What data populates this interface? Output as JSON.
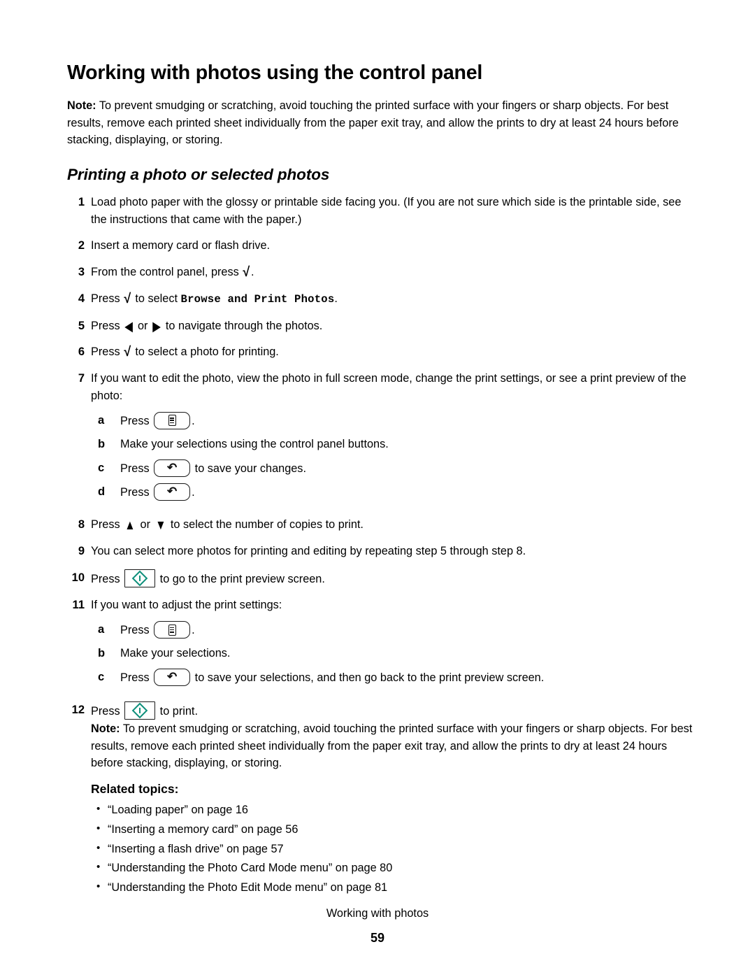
{
  "document": {
    "title": "Working with photos using the control panel",
    "subtitle": "Printing a photo or selected photos",
    "intro_note_label": "Note:",
    "intro_note_text": " To prevent smudging or scratching, avoid touching the printed surface with your fingers or sharp objects. For best results, remove each printed sheet individually from the paper exit tray, and allow the prints to dry at least 24 hours before stacking, displaying, or storing."
  },
  "steps": [
    {
      "num": "1",
      "text": "Load photo paper with the glossy or printable side facing you. (If you are not sure which side is the printable side, see the instructions that came with the paper.)"
    },
    {
      "num": "2",
      "text": "Insert a memory card or flash drive."
    },
    {
      "num": "3",
      "pre": "From the control panel, press ",
      "glyph": "√",
      "post": "."
    },
    {
      "num": "4",
      "pre": "Press ",
      "glyph": "√",
      "mid": " to select ",
      "mono": "Browse and Print Photos",
      "post": "."
    },
    {
      "num": "5",
      "pre": "Press ",
      "glyph_left": "◀",
      "mid": " or ",
      "glyph_right": "▶",
      "post": " to navigate through the photos."
    },
    {
      "num": "6",
      "pre": "Press ",
      "glyph": "√",
      "post": " to select a photo for printing."
    },
    {
      "num": "7",
      "text": "If you want to edit the photo, view the photo in full screen mode, change the print settings, or see a print preview of the photo:",
      "substeps": [
        {
          "letter": "a",
          "pre": "Press ",
          "button": "menu-button",
          "post": "."
        },
        {
          "letter": "b",
          "pre": "Make your selections using the control panel buttons.",
          "button": null,
          "post": ""
        },
        {
          "letter": "c",
          "pre": "Press ",
          "button": "back-button",
          "post": " to save your changes."
        },
        {
          "letter": "d",
          "pre": "Press ",
          "button": "back-button",
          "post": "."
        }
      ]
    },
    {
      "num": "8",
      "pre": "Press ",
      "glyph_up": "▲",
      "mid": " or ",
      "glyph_down": "▼",
      "post": " to select the number of copies to print."
    },
    {
      "num": "9",
      "text": "You can select more photos for printing and editing by repeating step 5 through step 8."
    },
    {
      "num": "10",
      "pre": "Press ",
      "button": "start-button",
      "post": " to go to the print preview screen."
    },
    {
      "num": "11",
      "text": "If you want to adjust the print settings:",
      "substeps": [
        {
          "letter": "a",
          "pre": "Press ",
          "button": "menu-button",
          "post": "."
        },
        {
          "letter": "b",
          "pre": "Make your selections.",
          "button": null,
          "post": ""
        },
        {
          "letter": "c",
          "pre": "Press ",
          "button": "back-button",
          "post": " to save your selections, and then go back to the print preview screen."
        }
      ]
    },
    {
      "num": "12",
      "pre": "Press ",
      "button": "start-button",
      "post": " to print."
    }
  ],
  "final_note": {
    "label": "Note:",
    "text": " To prevent smudging or scratching, avoid touching the printed surface with your fingers or sharp objects. For best results, remove each printed sheet individually from the paper exit tray, and allow the prints to dry at least 24 hours before stacking, displaying, or storing."
  },
  "related": {
    "heading": "Related topics:",
    "items": [
      "“Loading paper” on page 16",
      "“Inserting a memory card” on page 56",
      "“Inserting a flash drive” on page 57",
      "“Understanding the Photo Card Mode menu” on page 80",
      "“Understanding the Photo Edit Mode menu” on page 81"
    ]
  },
  "buttons": {
    "back_glyph": "↶",
    "start_accent_color": "#0d8f7a"
  },
  "footer": {
    "label": "Working with photos",
    "page_number": "59"
  }
}
